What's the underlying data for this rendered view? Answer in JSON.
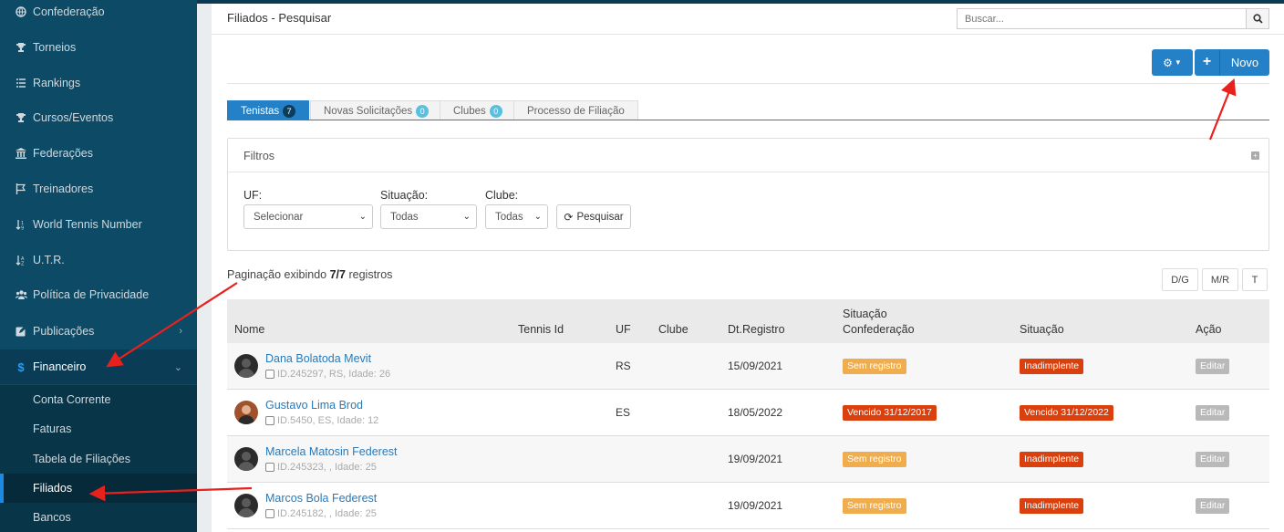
{
  "sidebar": {
    "items": [
      {
        "label": "Confederação",
        "icon": "globe-icon"
      },
      {
        "label": "Torneios",
        "icon": "trophy-icon"
      },
      {
        "label": "Rankings",
        "icon": "list-icon"
      },
      {
        "label": "Cursos/Eventos",
        "icon": "trophy-icon"
      },
      {
        "label": "Federações",
        "icon": "bank-icon"
      },
      {
        "label": "Treinadores",
        "icon": "flag-icon"
      },
      {
        "label": "World Tennis Number",
        "icon": "sort-icon"
      },
      {
        "label": "U.T.R.",
        "icon": "sort-icon"
      },
      {
        "label": "Política de Privacidade",
        "icon": "users-icon"
      },
      {
        "label": "Publicações",
        "icon": "edit-icon"
      },
      {
        "label": "Financeiro",
        "icon": "dollar-icon"
      }
    ],
    "sub_items": [
      {
        "label": "Conta Corrente"
      },
      {
        "label": "Faturas"
      },
      {
        "label": "Tabela de Filiações"
      },
      {
        "label": "Filiados"
      },
      {
        "label": "Bancos"
      }
    ]
  },
  "header": {
    "title": "Filiados - Pesquisar",
    "search_placeholder": "Buscar..."
  },
  "toolbar": {
    "new_label": "Novo"
  },
  "tabs": [
    {
      "label": "Tenistas",
      "badge": "7"
    },
    {
      "label": "Novas Solicitações",
      "badge": "0"
    },
    {
      "label": "Clubes",
      "badge": "0"
    },
    {
      "label": "Processo de Filiação"
    }
  ],
  "filters": {
    "title": "Filtros",
    "uf_label": "UF:",
    "uf_value": "Selecionar",
    "situacao_label": "Situação:",
    "situacao_value": "Todas",
    "clube_label": "Clube:",
    "clube_value": "Todas",
    "search_label": "Pesquisar"
  },
  "pagination": {
    "prefix": "Paginação exibindo",
    "count": "7/7",
    "suffix": "registros"
  },
  "view_buttons": [
    "D/G",
    "M/R",
    "T"
  ],
  "table": {
    "headers": {
      "nome": "Nome",
      "tennis_id": "Tennis Id",
      "uf": "UF",
      "clube": "Clube",
      "dt_registro": "Dt.Registro",
      "sit_conf_1": "Situação",
      "sit_conf_2": "Confederação",
      "situacao": "Situação",
      "acao": "Ação"
    },
    "rows": [
      {
        "name": "Dana Bolatoda Mevit",
        "meta": "ID.245297, RS, Idade: 26",
        "uf": "RS",
        "dt": "15/09/2021",
        "conf": "Sem registro",
        "sit": "Inadimplente",
        "action": "Editar"
      },
      {
        "name": "Gustavo Lima Brod",
        "meta": "ID.5450, ES, Idade: 12",
        "uf": "ES",
        "dt": "18/05/2022",
        "conf": "Vencido 31/12/2017",
        "sit": "Vencido 31/12/2022",
        "action": "Editar"
      },
      {
        "name": "Marcela Matosin Federest",
        "meta": "ID.245323, , Idade: 25",
        "uf": "",
        "dt": "19/09/2021",
        "conf": "Sem registro",
        "sit": "Inadimplente",
        "action": "Editar"
      },
      {
        "name": "Marcos Bola Federest",
        "meta": "ID.245182, , Idade: 25",
        "uf": "",
        "dt": "19/09/2021",
        "conf": "Sem registro",
        "sit": "Inadimplente",
        "action": "Editar"
      }
    ]
  },
  "colors": {
    "primary": "#2481c8",
    "sidebar": "#0c4a66",
    "warning": "#f0ad4e",
    "danger": "#d9400e",
    "annotation_arrow": "#e8211d"
  }
}
